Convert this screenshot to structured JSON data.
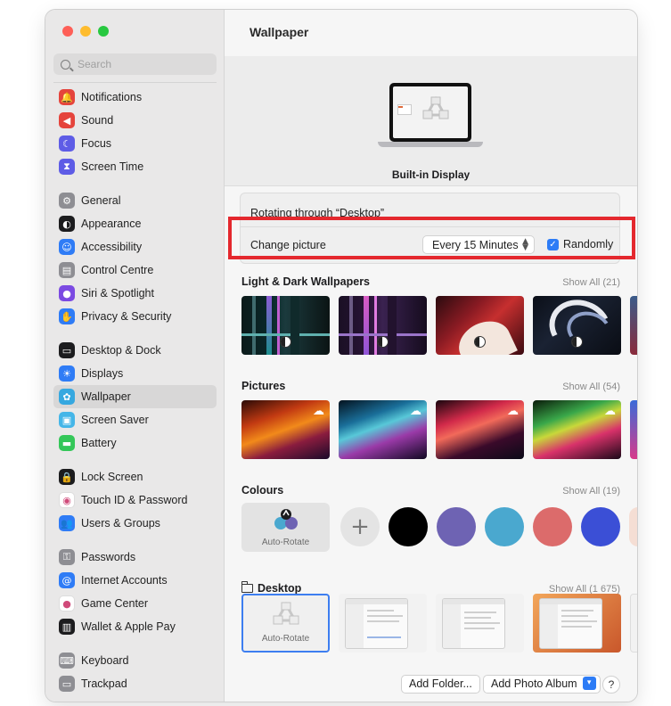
{
  "window": {
    "traffic_lights": [
      "close",
      "minimize",
      "zoom"
    ]
  },
  "search": {
    "placeholder": "Search"
  },
  "sidebar": {
    "groups": [
      [
        {
          "label": "Notifications",
          "icon": "bell-icon",
          "color": "#e5443c"
        },
        {
          "label": "Sound",
          "icon": "speaker-icon",
          "color": "#e5443c"
        },
        {
          "label": "Focus",
          "icon": "moon-icon",
          "color": "#5e5ce6"
        },
        {
          "label": "Screen Time",
          "icon": "hourglass-icon",
          "color": "#5e5ce6"
        }
      ],
      [
        {
          "label": "General",
          "icon": "gear-icon",
          "color": "#8e8e93"
        },
        {
          "label": "Appearance",
          "icon": "appearance-icon",
          "color": "#1c1c1e"
        },
        {
          "label": "Accessibility",
          "icon": "accessibility-icon",
          "color": "#2f7cf6"
        },
        {
          "label": "Control Centre",
          "icon": "control-centre-icon",
          "color": "#8e8e93"
        },
        {
          "label": "Siri & Spotlight",
          "icon": "siri-icon",
          "color": "#7b4ae2"
        },
        {
          "label": "Privacy & Security",
          "icon": "hand-icon",
          "color": "#2f7cf6"
        }
      ],
      [
        {
          "label": "Desktop & Dock",
          "icon": "dock-icon",
          "color": "#1c1c1e"
        },
        {
          "label": "Displays",
          "icon": "sun-icon",
          "color": "#2f7cf6"
        },
        {
          "label": "Wallpaper",
          "icon": "wallpaper-icon",
          "color": "#36a8e0",
          "selected": true
        },
        {
          "label": "Screen Saver",
          "icon": "screen-saver-icon",
          "color": "#45b6e8"
        },
        {
          "label": "Battery",
          "icon": "battery-icon",
          "color": "#34c759"
        }
      ],
      [
        {
          "label": "Lock Screen",
          "icon": "lock-icon",
          "color": "#1c1c1e"
        },
        {
          "label": "Touch ID & Password",
          "icon": "fingerprint-icon",
          "color": "#ffffff"
        },
        {
          "label": "Users & Groups",
          "icon": "users-icon",
          "color": "#2f7cf6"
        }
      ],
      [
        {
          "label": "Passwords",
          "icon": "key-icon",
          "color": "#8e8e93"
        },
        {
          "label": "Internet Accounts",
          "icon": "at-icon",
          "color": "#2f7cf6"
        },
        {
          "label": "Game Center",
          "icon": "game-center-icon",
          "color": "#ffffff"
        },
        {
          "label": "Wallet & Apple Pay",
          "icon": "wallet-icon",
          "color": "#1c1c1e"
        }
      ],
      [
        {
          "label": "Keyboard",
          "icon": "keyboard-icon",
          "color": "#8e8e93"
        },
        {
          "label": "Trackpad",
          "icon": "trackpad-icon",
          "color": "#8e8e93"
        }
      ]
    ]
  },
  "main": {
    "title": "Wallpaper",
    "display_label": "Built-in Display",
    "rotating_text": "Rotating through “Desktop”",
    "change_picture_label": "Change picture",
    "interval_value": "Every 15 Minutes",
    "randomly_label": "Randomly",
    "randomly_checked": true,
    "sections": {
      "light_dark": {
        "title": "Light & Dark Wallpapers",
        "show_all": "Show All (21)"
      },
      "pictures": {
        "title": "Pictures",
        "show_all": "Show All (54)"
      },
      "colours": {
        "title": "Colours",
        "show_all": "Show All (19)",
        "auto_rotate_label": "Auto-Rotate"
      },
      "desktop": {
        "title": "Desktop",
        "show_all": "Show All (1 675)",
        "auto_rotate_label": "Auto-Rotate"
      }
    },
    "colour_swatches": [
      "#000000",
      "#6e63b3",
      "#4aa8cf",
      "#dc6b6b",
      "#3b4fd6",
      "#f5ded4"
    ],
    "buttons": {
      "add_folder": "Add Folder...",
      "add_photo_album": "Add Photo Album",
      "help": "?"
    }
  }
}
